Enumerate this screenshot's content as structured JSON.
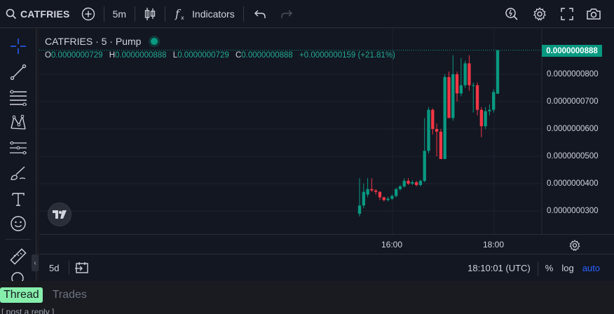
{
  "topbar": {
    "symbol": "CATFRIES",
    "interval": "5m",
    "indicators_label": "Indicators",
    "icons": [
      "search-icon",
      "add-symbol-icon",
      "candles-icon",
      "fx-icon",
      "undo-icon",
      "redo-icon",
      "quick-search-icon",
      "settings-icon",
      "fullscreen-icon",
      "camera-icon"
    ]
  },
  "left_toolbar": {
    "tools": [
      "crosshair-icon",
      "trend-line-icon",
      "fib-lines-icon",
      "pattern-icon",
      "measure-lines-icon",
      "brush-icon",
      "text-icon",
      "emoji-icon",
      "ruler-icon"
    ]
  },
  "legend": {
    "title": "CATFRIES · 5 · Pump",
    "open_label": "O",
    "open": "0.0000000729",
    "high_label": "H",
    "high": "0.0000000888",
    "low_label": "L",
    "low": "0.0000000729",
    "close_label": "C",
    "close": "0.0000000888",
    "change": "+0.0000000159 (+21.81%)"
  },
  "price_axis": {
    "current_price": "0.0000000888",
    "labels": [
      "0.0000000800",
      "0.0000000700",
      "0.0000000600",
      "0.0000000500",
      "0.0000000400",
      "0.0000000300"
    ]
  },
  "time_axis": {
    "labels": [
      "16:00",
      "18:00"
    ]
  },
  "bottom_bar": {
    "range": "5d",
    "clock": "18:10:01 (UTC)",
    "percent": "%",
    "log": "log",
    "auto": "auto"
  },
  "tabs": {
    "thread": "Thread",
    "trades": "Trades"
  },
  "below_text": "[ post a reply ]",
  "colors": {
    "up": "#089981",
    "down": "#f23645",
    "accent": "#2962ff",
    "tab_active": "#86efac"
  },
  "chart_data": {
    "type": "candlestick",
    "x_labels": [
      "16:00",
      "18:00"
    ],
    "ylim": [
      2.5e-08,
      9.05e-08
    ],
    "candles": [
      {
        "o": 2.9e-08,
        "h": 4.2e-08,
        "l": 2.8e-08,
        "c": 3.2e-08
      },
      {
        "o": 3.2e-08,
        "h": 4e-08,
        "l": 3.1e-08,
        "c": 3.7e-08
      },
      {
        "o": 3.6e-08,
        "h": 4.2e-08,
        "l": 3.5e-08,
        "c": 3.8e-08
      },
      {
        "o": 3.8e-08,
        "h": 4.2e-08,
        "l": 3.7e-08,
        "c": 3.75e-08
      },
      {
        "o": 3.75e-08,
        "h": 3.8e-08,
        "l": 3.6e-08,
        "c": 3.7e-08
      },
      {
        "o": 3.7e-08,
        "h": 3.72e-08,
        "l": 3.4e-08,
        "c": 3.5e-08
      },
      {
        "o": 3.5e-08,
        "h": 3.52e-08,
        "l": 3.35e-08,
        "c": 3.4e-08
      },
      {
        "o": 3.4e-08,
        "h": 3.52e-08,
        "l": 3.35e-08,
        "c": 3.45e-08
      },
      {
        "o": 3.45e-08,
        "h": 3.6e-08,
        "l": 3.4e-08,
        "c": 3.55e-08
      },
      {
        "o": 3.55e-08,
        "h": 3.85e-08,
        "l": 3.5e-08,
        "c": 3.8e-08
      },
      {
        "o": 3.8e-08,
        "h": 3.95e-08,
        "l": 3.75e-08,
        "c": 3.9e-08
      },
      {
        "o": 3.9e-08,
        "h": 4.2e-08,
        "l": 3.85e-08,
        "c": 4.1e-08
      },
      {
        "o": 4.1e-08,
        "h": 4.2e-08,
        "l": 3.95e-08,
        "c": 4e-08
      },
      {
        "o": 4e-08,
        "h": 4.12e-08,
        "l": 3.95e-08,
        "c": 4.05e-08
      },
      {
        "o": 4.05e-08,
        "h": 4.1e-08,
        "l": 3.9e-08,
        "c": 3.95e-08
      },
      {
        "o": 3.95e-08,
        "h": 4.15e-08,
        "l": 3.9e-08,
        "c": 4.1e-08
      },
      {
        "o": 4.1e-08,
        "h": 6.4e-08,
        "l": 4.05e-08,
        "c": 5.2e-08
      },
      {
        "o": 5.2e-08,
        "h": 6.8e-08,
        "l": 5.1e-08,
        "c": 6.7e-08
      },
      {
        "o": 6.7e-08,
        "h": 6.75e-08,
        "l": 5.8e-08,
        "c": 6e-08
      },
      {
        "o": 6e-08,
        "h": 6.2e-08,
        "l": 5e-08,
        "c": 5.9e-08
      },
      {
        "o": 5.9e-08,
        "h": 6e-08,
        "l": 4.9e-08,
        "c": 4.9e-08
      },
      {
        "o": 4.9e-08,
        "h": 8e-08,
        "l": 4.9e-08,
        "c": 7.9e-08
      },
      {
        "o": 7.9e-08,
        "h": 8.1e-08,
        "l": 6.4e-08,
        "c": 6.4e-08
      },
      {
        "o": 6.4e-08,
        "h": 8.7e-08,
        "l": 6.3e-08,
        "c": 8e-08
      },
      {
        "o": 8e-08,
        "h": 8.1e-08,
        "l": 7e-08,
        "c": 7.3e-08
      },
      {
        "o": 7.3e-08,
        "h": 8.6e-08,
        "l": 7.2e-08,
        "c": 7.6e-08
      },
      {
        "o": 7.6e-08,
        "h": 8.5e-08,
        "l": 7.5e-08,
        "c": 8.4e-08
      },
      {
        "o": 8.4e-08,
        "h": 8.7e-08,
        "l": 7.4e-08,
        "c": 7.6e-08
      },
      {
        "o": 7.6e-08,
        "h": 7.7e-08,
        "l": 6.6e-08,
        "c": 7.6e-08
      },
      {
        "o": 7.6e-08,
        "h": 7.7e-08,
        "l": 6.5e-08,
        "c": 6.7e-08
      },
      {
        "o": 6.7e-08,
        "h": 6.8e-08,
        "l": 5.7e-08,
        "c": 6.1e-08
      },
      {
        "o": 6.1e-08,
        "h": 6.8e-08,
        "l": 6e-08,
        "c": 6.65e-08
      },
      {
        "o": 6.65e-08,
        "h": 6.9e-08,
        "l": 6.5e-08,
        "c": 6.7e-08
      },
      {
        "o": 6.7e-08,
        "h": 7.45e-08,
        "l": 6.6e-08,
        "c": 7.35e-08
      },
      {
        "o": 7.29e-08,
        "h": 8.88e-08,
        "l": 7.29e-08,
        "c": 8.88e-08
      }
    ]
  }
}
